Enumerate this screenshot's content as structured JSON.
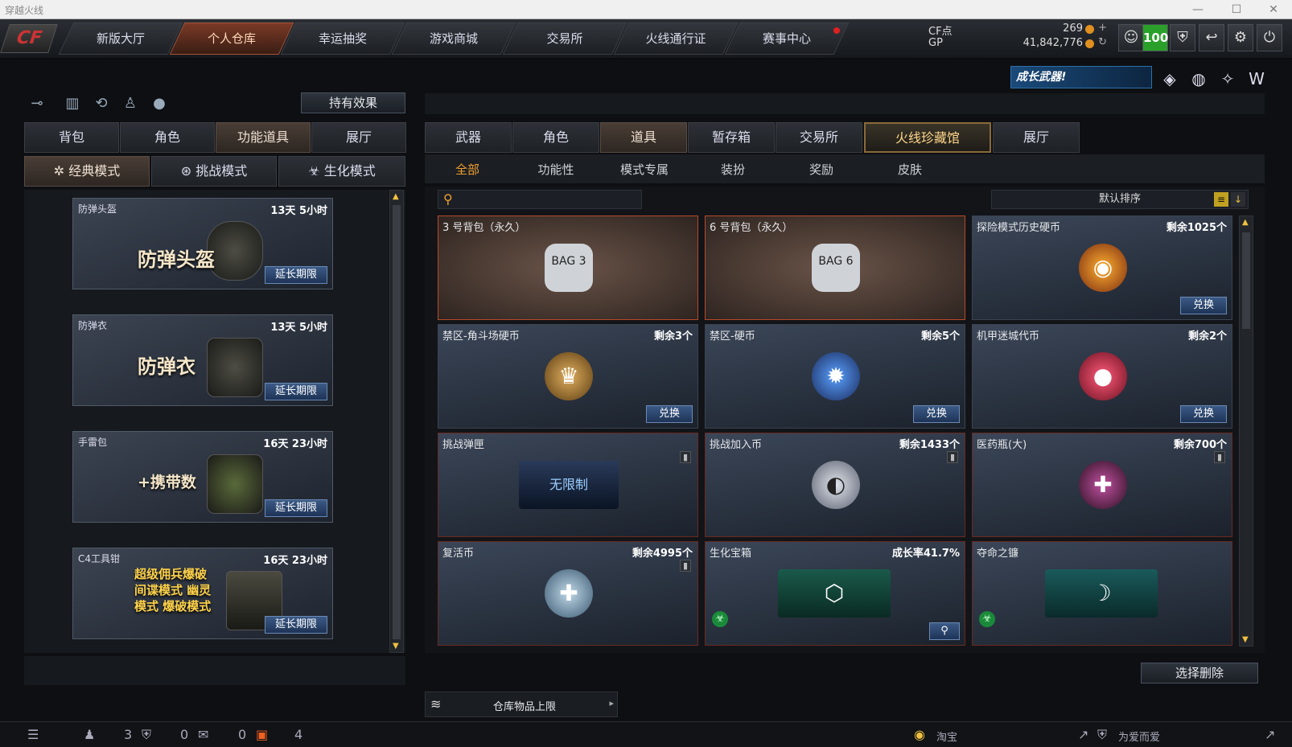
{
  "window": {
    "title": "穿越火线"
  },
  "nav": {
    "logo": "CF",
    "tabs": [
      "新版大厅",
      "个人仓库",
      "幸运抽奖",
      "游戏商城",
      "交易所",
      "火线通行证",
      "赛事中心"
    ],
    "active_index": 1
  },
  "currency": {
    "cf_label": "CF点",
    "cf_value": "269",
    "gp_label": "GP",
    "gp_value": "41,842,776",
    "level": "100"
  },
  "banner": {
    "text": "成长武器!"
  },
  "left": {
    "hold_effect_button": "持有效果",
    "tabs": [
      "背包",
      "角色",
      "功能道具",
      "展厅"
    ],
    "active_tab": 2,
    "modes": [
      "经典模式",
      "挑战模式",
      "生化模式"
    ],
    "items": [
      {
        "name": "防弹头盔",
        "time": "13天 5小时",
        "picture_label": "防弹头盔",
        "extend": "延长期限"
      },
      {
        "name": "防弹衣",
        "time": "13天 5小时",
        "picture_label": "防弹衣",
        "extend": "延长期限"
      },
      {
        "name": "手雷包",
        "time": "16天 23小时",
        "picture_label": "+携带数",
        "extend": "延长期限"
      },
      {
        "name": "C4工具钳",
        "time": "16天 23小时",
        "picture_label": "超级佣兵爆破 间谍模式 幽灵模式 爆破模式",
        "extend": "延长期限"
      }
    ]
  },
  "right": {
    "tabs": [
      "武器",
      "角色",
      "道具",
      "暂存箱",
      "交易所",
      "火线珍藏馆",
      "展厅"
    ],
    "active_tab": 2,
    "highlight_tab": 5,
    "subtabs": [
      "全部",
      "功能性",
      "模式专属",
      "装扮",
      "奖励",
      "皮肤"
    ],
    "active_subtab": 0,
    "search_placeholder": "",
    "sort_label": "默认排序",
    "cells": [
      {
        "name": "3 号背包（永久）",
        "right": "",
        "button": "",
        "icon": "BAG 3"
      },
      {
        "name": "6 号背包（永久）",
        "right": "",
        "button": "",
        "icon": "BAG 6"
      },
      {
        "name": "探险模式历史硬币",
        "right": "剩余1025个",
        "button": "兑换",
        "icon": "◉"
      },
      {
        "name": "禁区-角斗场硬币",
        "right": "剩余3个",
        "button": "兑换",
        "icon": "♛"
      },
      {
        "name": "禁区-硬币",
        "right": "剩余5个",
        "button": "兑换",
        "icon": "✹"
      },
      {
        "name": "机甲迷城代币",
        "right": "剩余2个",
        "button": "兑换",
        "icon": "●"
      },
      {
        "name": "挑战弹匣",
        "right": "",
        "button": "",
        "icon": "无限制"
      },
      {
        "name": "挑战加入币",
        "right": "剩余1433个",
        "button": "",
        "icon": "◐"
      },
      {
        "name": "医药瓶(大)",
        "right": "剩余700个",
        "button": "",
        "icon": "✚"
      },
      {
        "name": "复活币",
        "right": "剩余4995个",
        "button": "",
        "icon": "✚"
      },
      {
        "name": "生化宝箱",
        "right": "成长率41.7%",
        "button": "",
        "icon": "⬡"
      },
      {
        "name": "夺命之镰",
        "right": "",
        "button": "",
        "icon": "☽"
      }
    ],
    "select_delete": "选择删除",
    "storage_limit": "仓库物品上限"
  },
  "bottom": {
    "count1": "3",
    "count2": "0",
    "count3": "0",
    "count4": "4",
    "taobao": "淘宝",
    "love": "为爱而爱"
  },
  "colors": {
    "accent": "#f0a030",
    "frame": "#6a2a20",
    "button": "#2a4a78"
  }
}
